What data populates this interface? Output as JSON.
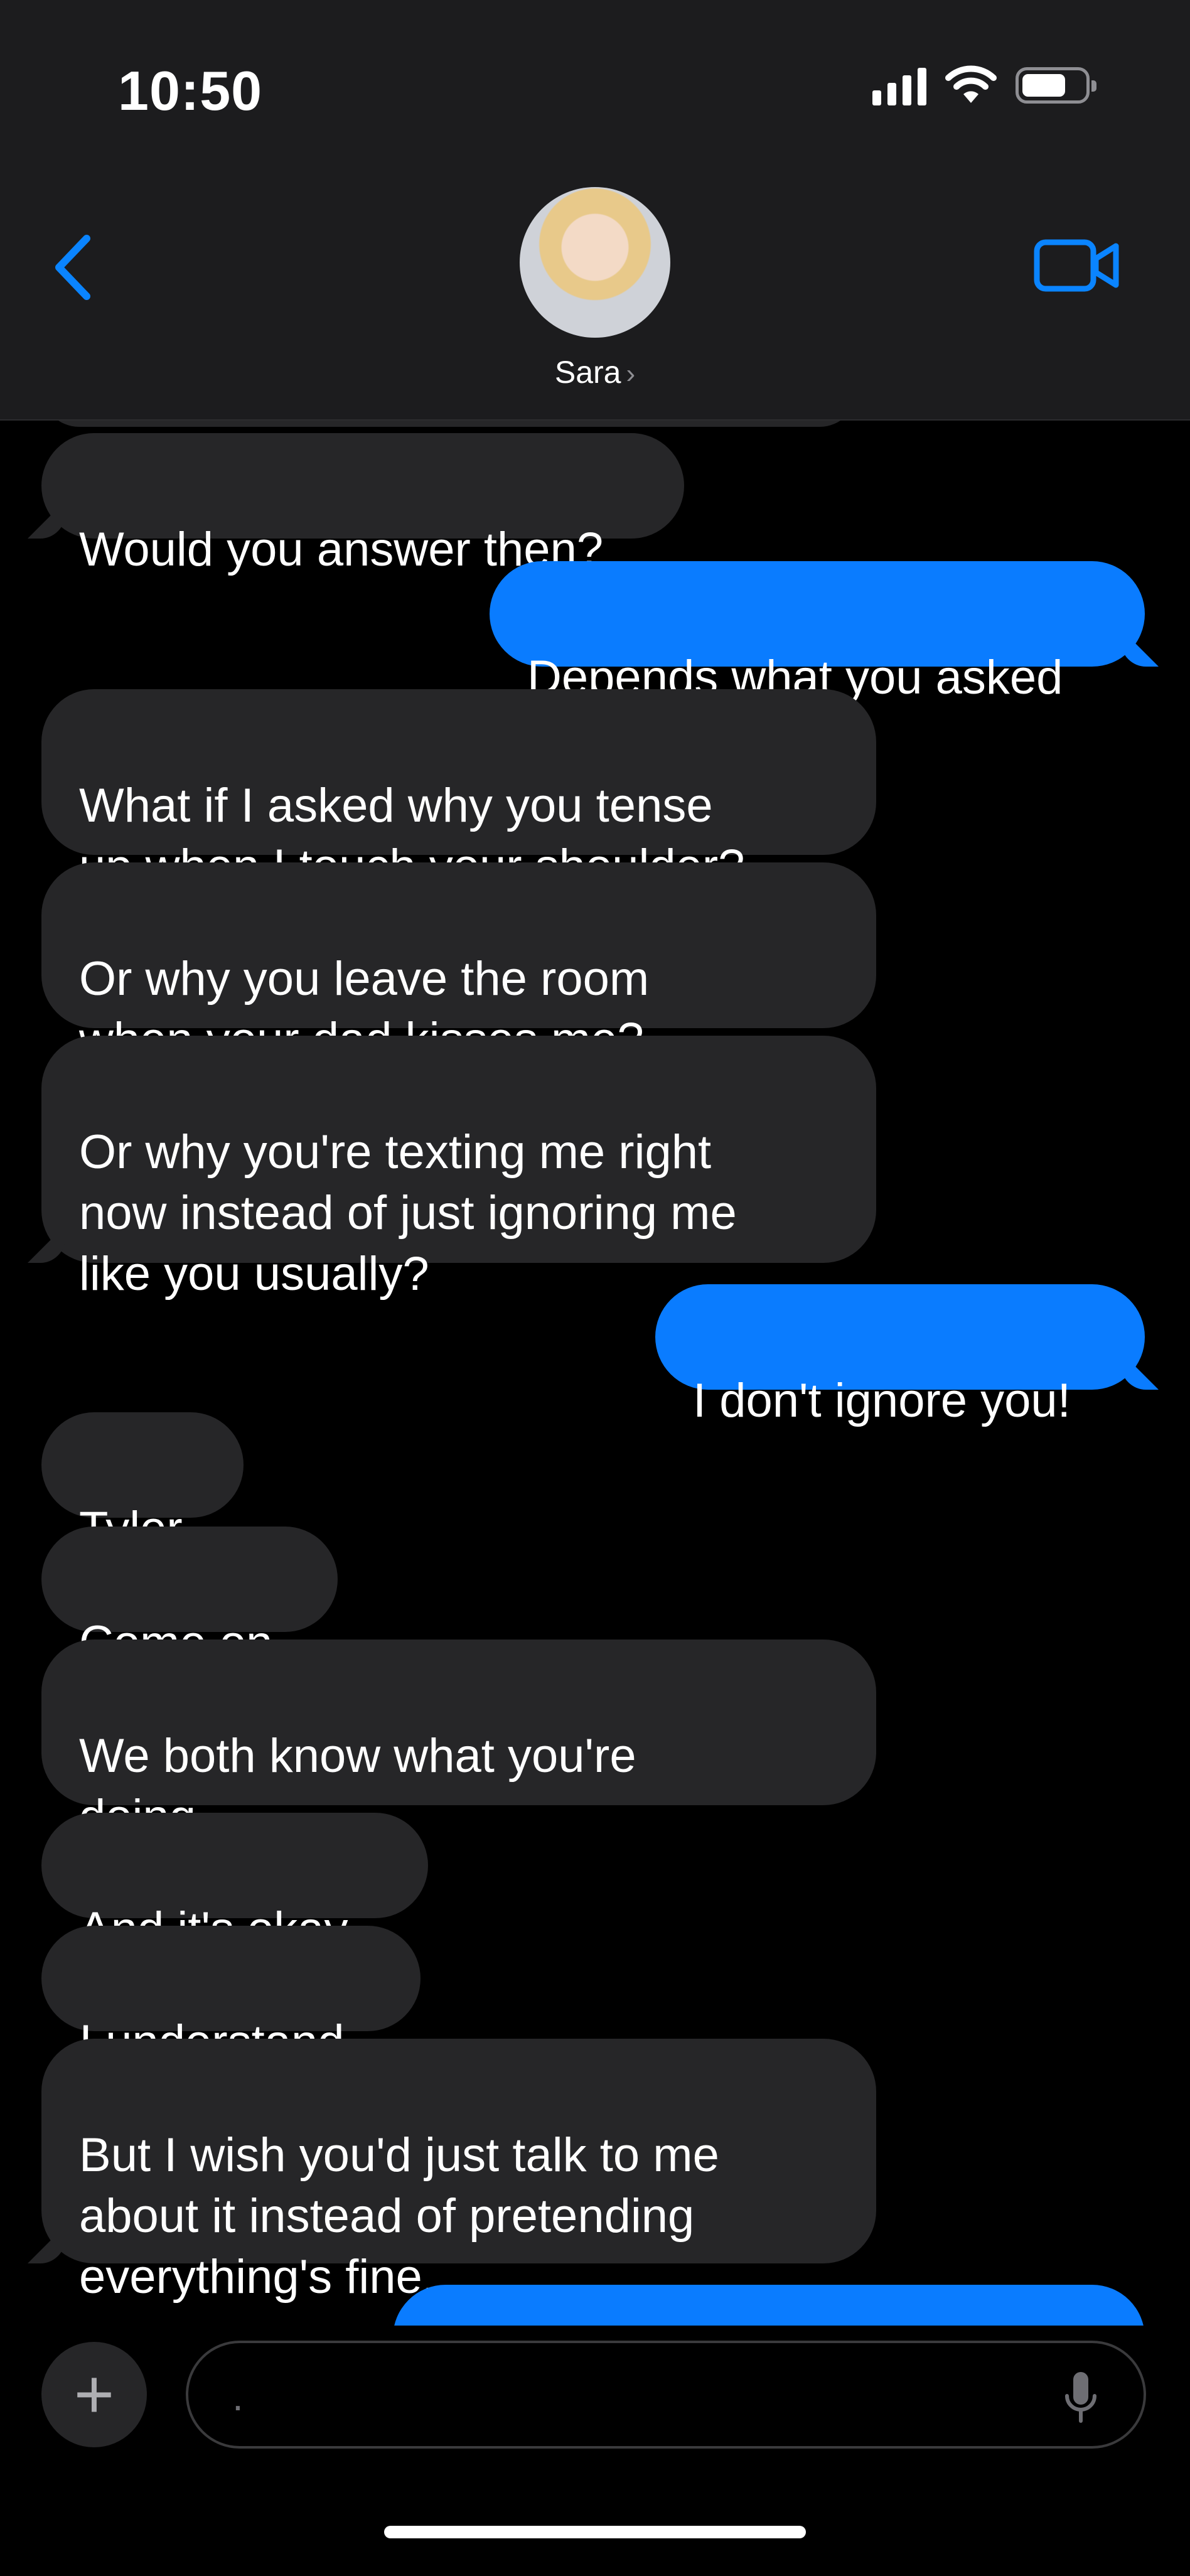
{
  "status_bar": {
    "time": "10:50"
  },
  "header": {
    "contact_name": "Sara"
  },
  "messages": [
    {
      "dir": "in",
      "text": "Would you answer then?"
    },
    {
      "dir": "out",
      "text": "Depends what you asked"
    },
    {
      "dir": "in",
      "text": "What if I asked why you tense\nup when I touch your shoulder?"
    },
    {
      "dir": "in",
      "text": "Or why you leave the room\nwhen your dad kisses me?"
    },
    {
      "dir": "in",
      "text": "Or why you're texting me right\nnow instead of just ignoring me\nlike you usually?"
    },
    {
      "dir": "out",
      "text": "I don't ignore you!"
    },
    {
      "dir": "in",
      "text": "Tyler."
    },
    {
      "dir": "in",
      "text": "Come on."
    },
    {
      "dir": "in",
      "text": "We both know what you're\ndoing."
    },
    {
      "dir": "in",
      "text": "And it's okay."
    },
    {
      "dir": "in",
      "text": "I understand."
    },
    {
      "dir": "in",
      "text": "But I wish you'd just talk to me\nabout it instead of pretending\neverything's fine."
    }
  ],
  "composer": {
    "placeholder": "."
  },
  "colors": {
    "accent": "#0a7cff",
    "incoming_bubble": "#262628",
    "background": "#000000"
  }
}
